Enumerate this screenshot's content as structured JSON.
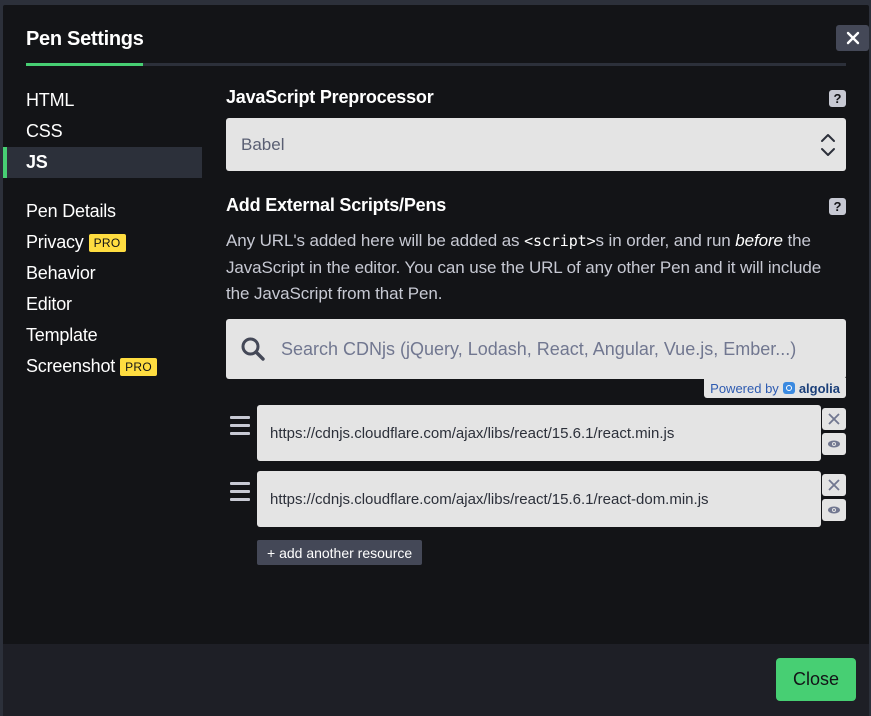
{
  "modal": {
    "title": "Pen Settings",
    "close_icon": "close-icon"
  },
  "sidebar": {
    "items": [
      {
        "label": "HTML",
        "active": false
      },
      {
        "label": "CSS",
        "active": false
      },
      {
        "label": "JS",
        "active": true
      },
      {
        "label": "Pen Details",
        "active": false
      },
      {
        "label": "Privacy",
        "badge": "PRO",
        "active": false
      },
      {
        "label": "Behavior",
        "active": false
      },
      {
        "label": "Editor",
        "active": false
      },
      {
        "label": "Template",
        "active": false
      },
      {
        "label": "Screenshot",
        "badge": "PRO",
        "active": false
      }
    ]
  },
  "preprocessor": {
    "title": "JavaScript Preprocessor",
    "help": "?",
    "value": "Babel"
  },
  "external": {
    "title": "Add External Scripts/Pens",
    "help": "?",
    "desc_part1": "Any URL's added here will be added as ",
    "desc_code": "<script>",
    "desc_part2": "s in order, and run ",
    "desc_em": "before",
    "desc_part3": " the JavaScript in the editor. You can use the URL of any other Pen and it will include the JavaScript from that Pen.",
    "search_placeholder": "Search CDNjs (jQuery, Lodash, React, Angular, Vue.js, Ember...)",
    "powered_by": "Powered by",
    "powered_brand": "algolia",
    "resources": [
      "https://cdnjs.cloudflare.com/ajax/libs/react/15.6.1/react.min.js",
      "https://cdnjs.cloudflare.com/ajax/libs/react/15.6.1/react-dom.min.js"
    ],
    "add_label": "+ add another resource"
  },
  "footer": {
    "close_label": "Close"
  },
  "colors": {
    "accent": "#47cf73",
    "pro_badge": "#ffdd40",
    "background": "#131417"
  }
}
